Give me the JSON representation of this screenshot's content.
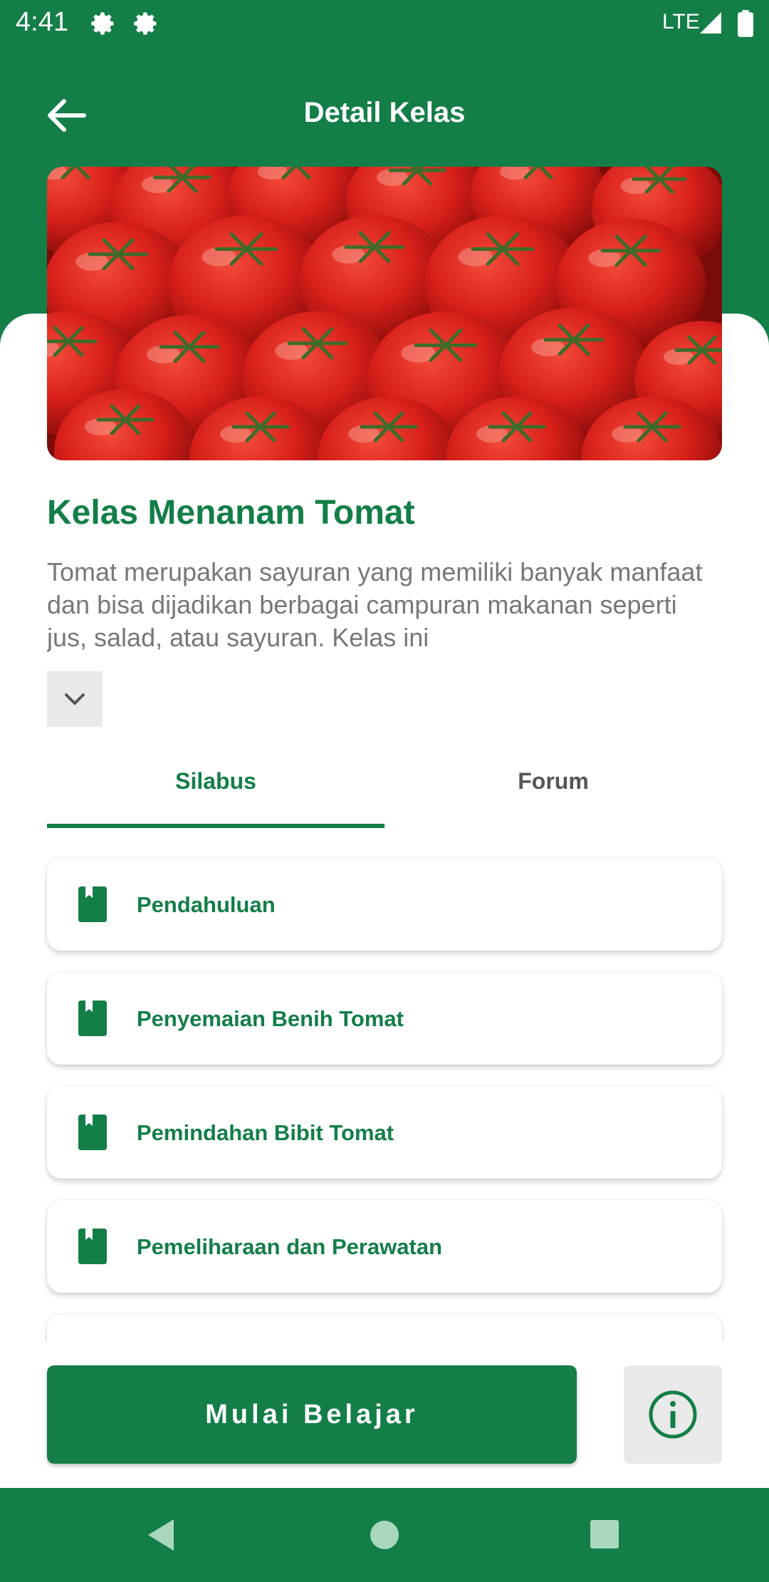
{
  "status_bar": {
    "time": "4:41",
    "network": "LTE"
  },
  "app_bar": {
    "title": "Detail Kelas",
    "back_icon": "arrow-left-icon"
  },
  "course": {
    "title": "Kelas Menanam Tomat",
    "description": "Tomat merupakan sayuran yang memiliki banyak manfaat dan bisa dijadikan berbagai campuran makanan seperti jus, salad, atau sayuran. Kelas ini",
    "expand_icon": "chevron-down-icon"
  },
  "tabs": [
    {
      "label": "Silabus",
      "active": true
    },
    {
      "label": "Forum",
      "active": false
    }
  ],
  "syllabus": [
    {
      "label": "Pendahuluan",
      "icon": "book-icon"
    },
    {
      "label": "Penyemaian Benih Tomat",
      "icon": "book-icon"
    },
    {
      "label": "Pemindahan Bibit Tomat",
      "icon": "book-icon"
    },
    {
      "label": "Pemeliharaan dan Perawatan",
      "icon": "book-icon"
    },
    {
      "label": "",
      "icon": "book-icon"
    }
  ],
  "actions": {
    "start_label": "Mulai Belajar",
    "info_icon": "info-icon"
  },
  "colors": {
    "primary": "#137E48",
    "text_gray": "#777777",
    "button_gray": "#E9E9E9",
    "tomato_red": "#D81F1A"
  }
}
